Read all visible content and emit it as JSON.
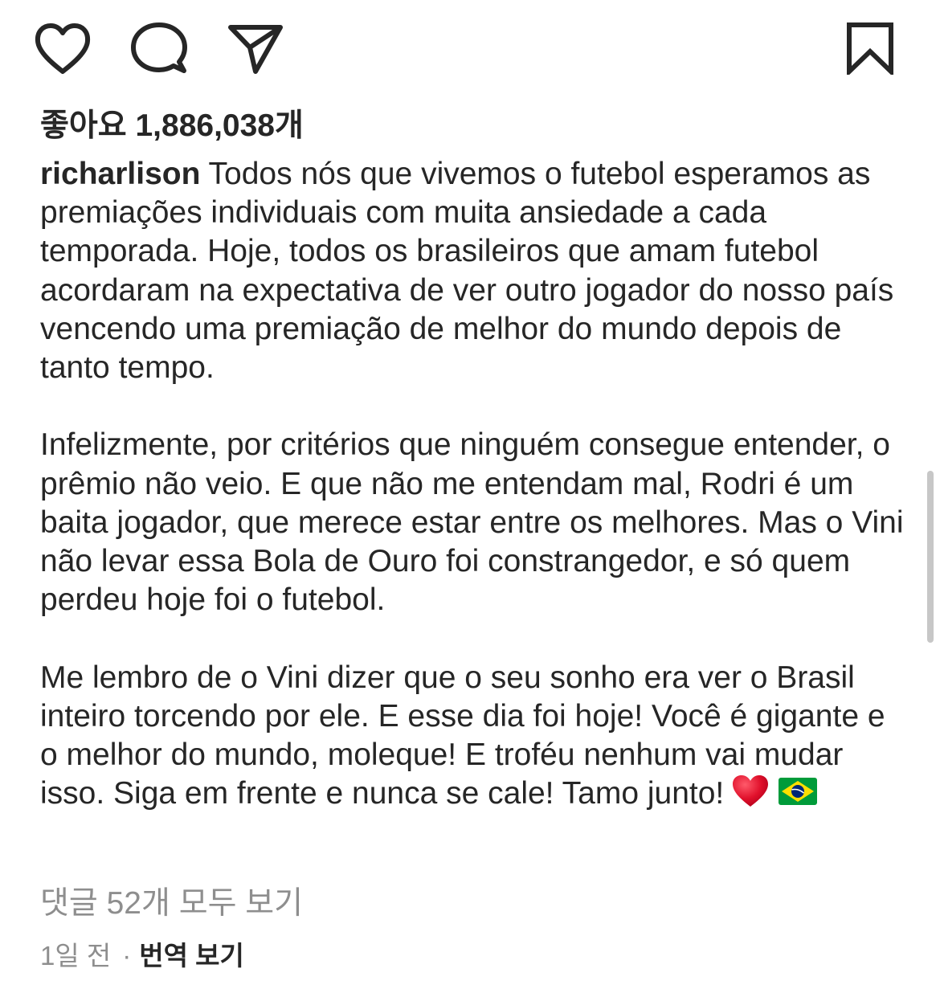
{
  "actions": {
    "like_icon": "heart-outline-icon",
    "comment_icon": "speech-bubble-icon",
    "share_icon": "paper-plane-icon",
    "save_icon": "bookmark-icon"
  },
  "likes": {
    "text": "좋아요 1,886,038개"
  },
  "caption": {
    "username": "richarlison",
    "paragraph_1": "Todos nós que vivemos o futebol esperamos as premiações individuais com muita ansiedade a cada temporada. Hoje, todos os brasileiros que amam futebol acordaram na expectativa de ver outro jogador do nosso país vencendo uma premiação de melhor do mundo depois de tanto tempo.",
    "paragraph_2": "Infelizmente, por critérios que ninguém consegue entender, o prêmio não veio. E que não me entendam mal, Rodri é um baita jogador, que merece estar entre os melhores. Mas o Vini não levar essa Bola de Ouro foi constrangedor, e só quem perdeu hoje foi o futebol.",
    "paragraph_3": "Me lembro de o Vini dizer que o seu sonho era ver o Brasil inteiro torcendo por ele. E esse dia foi hoje! Você é gigante e o melhor do mundo, moleque! E troféu nenhum vai mudar isso. Siga em frente e nunca se cale! Tamo junto!",
    "emojis": [
      "red-heart-emoji",
      "brazil-flag-emoji"
    ]
  },
  "comments": {
    "view_all": "댓글 52개 모두 보기"
  },
  "meta": {
    "time": "1일 전",
    "separator": "·",
    "translate": "번역 보기"
  },
  "colors": {
    "text_primary": "#262626",
    "text_secondary": "#8e8e8e",
    "heart_red": "#e0102b",
    "flag_green": "#009b3a",
    "flag_yellow": "#fedf00",
    "flag_blue": "#002776"
  }
}
